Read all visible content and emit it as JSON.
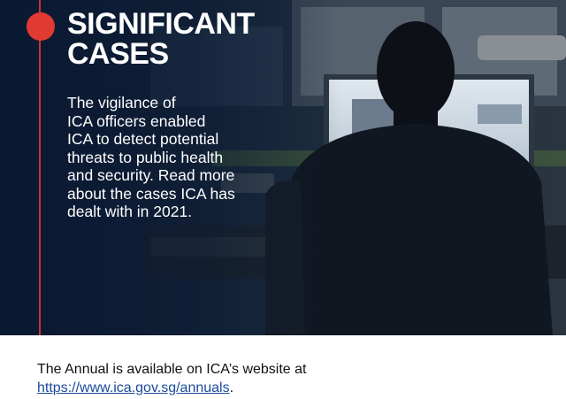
{
  "banner": {
    "title_lines": [
      "SIGNIFICANT",
      "CASES"
    ],
    "description_lines": [
      "The vigilance of",
      "ICA officers enabled",
      "ICA to detect potential",
      "threats to public health",
      "and security. Read more",
      "about the cases ICA has",
      "dealt with in 2021."
    ],
    "photo": "person-at-computer-desk",
    "accent_color": "#e03a32"
  },
  "footer": {
    "line1": "The Annual is available on ICA’s website at",
    "link_text": "https://www.ica.gov.sg/annuals",
    "link_suffix": ".",
    "link_color": "#1b4a9c"
  }
}
